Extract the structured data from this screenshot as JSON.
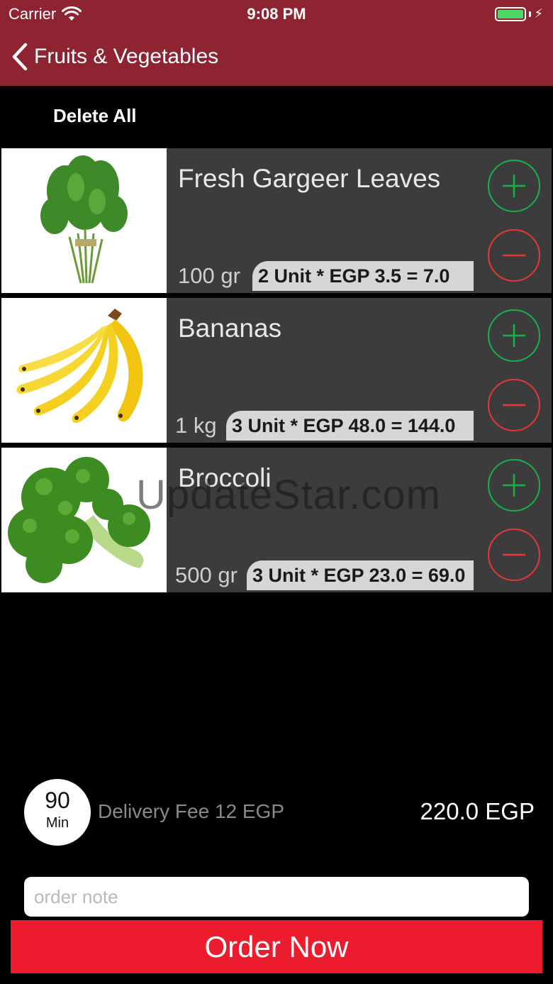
{
  "status_bar": {
    "carrier": "Carrier",
    "time": "9:08 PM"
  },
  "nav": {
    "title": "Fruits & Vegetables"
  },
  "actions": {
    "delete_all": "Delete All"
  },
  "items": [
    {
      "name": "Fresh Gargeer Leaves",
      "weight": "100 gr",
      "calc": "2 Unit * EGP 3.5 = 7.0"
    },
    {
      "name": "Bananas",
      "weight": "1 kg",
      "calc": "3 Unit * EGP 48.0 = 144.0"
    },
    {
      "name": "Broccoli",
      "weight": "500 gr",
      "calc": "3 Unit * EGP 23.0 = 69.0"
    }
  ],
  "watermark": "UpdateStar.com",
  "footer": {
    "time_value": "90",
    "time_unit": "Min",
    "delivery_fee": "Delivery Fee 12 EGP",
    "total": "220.0 EGP",
    "note_placeholder": "order note",
    "order_button": "Order Now"
  },
  "colors": {
    "nav_bg": "#8e2432",
    "order_button": "#ec1c2e",
    "plus": "#19b04a",
    "minus": "#e8363a"
  }
}
